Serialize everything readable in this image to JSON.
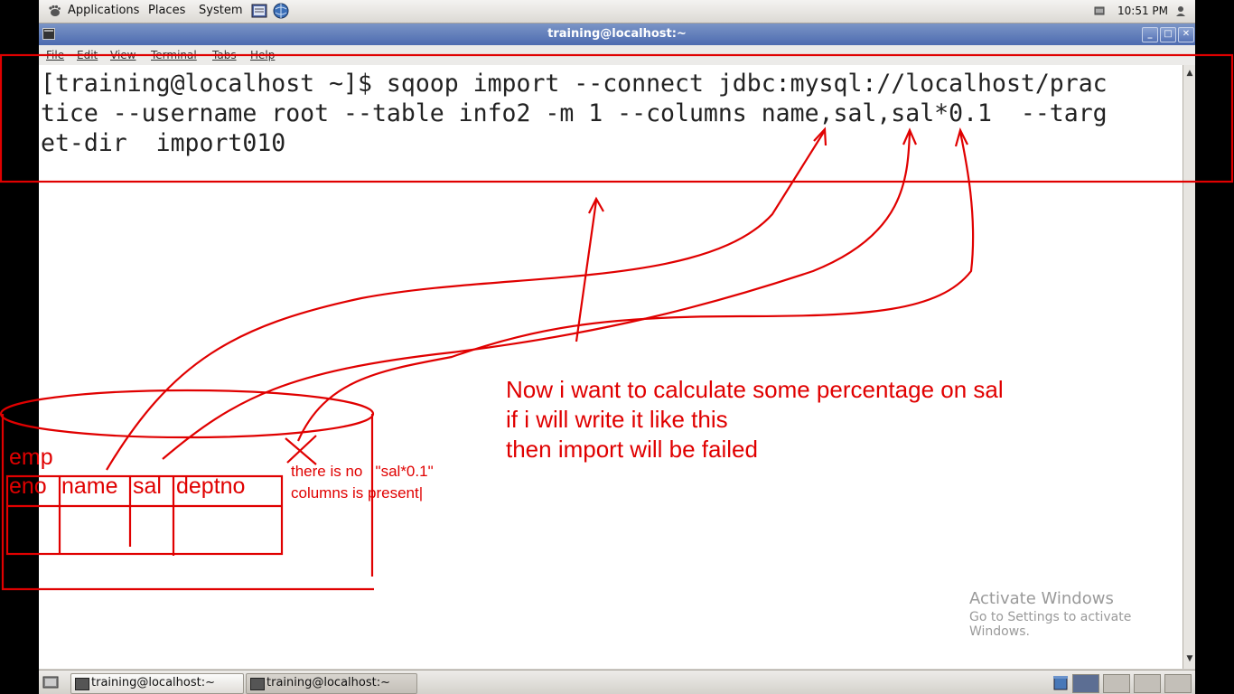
{
  "top_panel": {
    "menus": [
      "Applications",
      "Places",
      "System"
    ],
    "clock": "10:51 PM"
  },
  "window": {
    "title": "training@localhost:~",
    "buttons": {
      "minimize": "_",
      "maximize": "□",
      "close": "✕"
    }
  },
  "menubar": [
    "File",
    "Edit",
    "View",
    "Terminal",
    "Tabs",
    "Help"
  ],
  "terminal": {
    "lines": [
      "[training@localhost ~]$ sqoop import --connect jdbc:mysql://localhost/prac",
      "tice --username root --table info2 -m 1 --columns name,sal,sal*0.1  --targ",
      "et-dir  import010"
    ]
  },
  "taskbar": {
    "tasks": [
      "training@localhost:~",
      "training@localhost:~"
    ]
  },
  "watermark": {
    "line1": "Activate Windows",
    "line2": "Go to Settings to activate Windows."
  },
  "annotations": {
    "main_note": [
      "Now i want to calculate some percentage on sal",
      "if i will write it like this",
      "then import will be failed"
    ],
    "small_note": [
      "there is no   \"sal*0.1\"",
      "columns is present|"
    ],
    "table_name": "emp",
    "columns": [
      "eno",
      "name",
      "sal",
      "deptno"
    ]
  },
  "colors": {
    "annotation": "#e00000",
    "titlebar": "#5874b6",
    "terminal_bg": "#ffffff",
    "panel_bg": "#e4e1dc"
  },
  "icons": [
    "gnome-foot-icon",
    "notes-icon",
    "network-icon",
    "speaker-icon",
    "terminal-icon",
    "workspace-icon",
    "scroll-up-icon",
    "scroll-down-icon"
  ]
}
